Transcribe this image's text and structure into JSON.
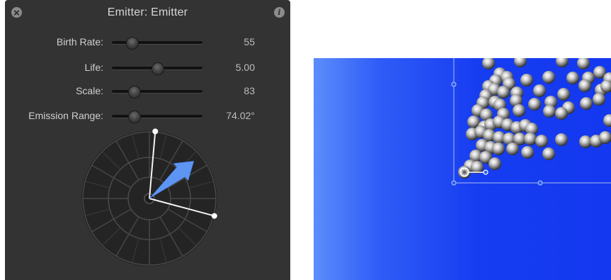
{
  "hud": {
    "title": "Emitter: Emitter",
    "close_icon": "close-icon",
    "info_icon": "info-icon",
    "info_glyph": "i",
    "params": [
      {
        "label": "Birth Rate:",
        "value": "55",
        "slider_fraction": 0.22
      },
      {
        "label": "Life:",
        "value": "5.00",
        "slider_fraction": 0.5
      },
      {
        "label": "Scale:",
        "value": "83",
        "slider_fraction": 0.24
      },
      {
        "label": "Emission Range:",
        "value": "74.02°",
        "slider_fraction": 0.24
      }
    ],
    "dial": {
      "emission_angle_deg": 40,
      "range_start_deg": -15,
      "range_end_deg": 85
    }
  },
  "canvas": {
    "background_left": "#5c8dfb",
    "background_right": "#1338f0",
    "particle_color": "#c8c8c8"
  }
}
